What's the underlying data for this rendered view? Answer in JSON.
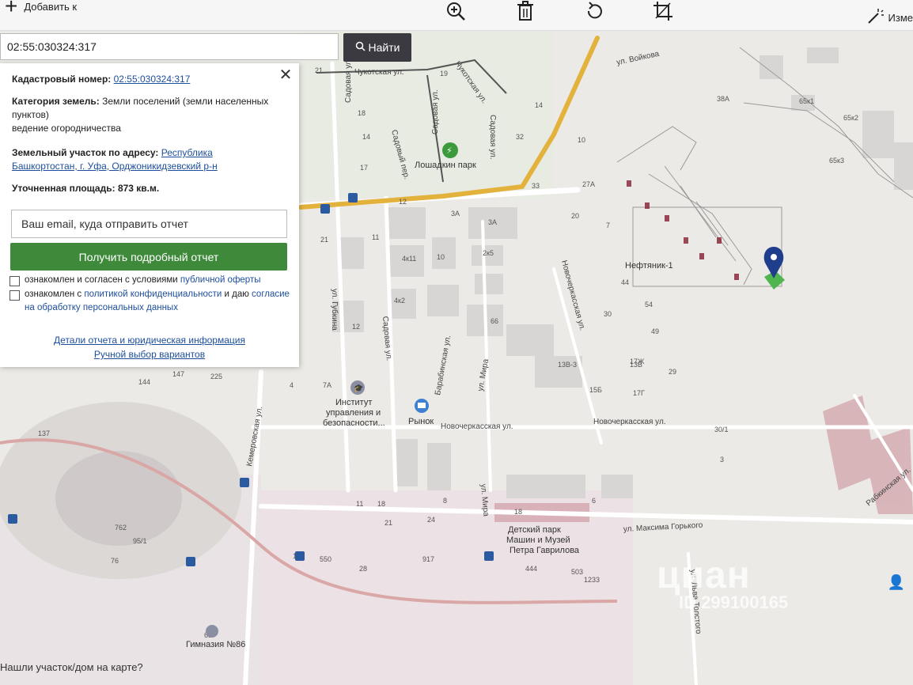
{
  "toolbar": {
    "add_label": "Добавить к",
    "edit_label": "Изме"
  },
  "search": {
    "value": "02:55:030324:317",
    "button_label": "Найти"
  },
  "panel": {
    "cadastral_label": "Кадастровый номер:",
    "cadastral_value": "02:55:030324:317",
    "category_label": "Категория земель:",
    "category_value": "Земли поселений (земли населенных пунктов)",
    "usage": "ведение огородничества",
    "address_label": "Земельный участок по адресу:",
    "address_value": "Республика Башкортостан, г. Уфа, Орджоникидзевский р-н",
    "area_label": "Уточненная площадь:",
    "area_value": "873 кв.м.",
    "email_placeholder": "Ваш email, куда отправить отчет",
    "report_button": "Получить подробный отчет",
    "consent1_text": "ознакомлен и согласен с условиями",
    "consent1_link": "публичной оферты",
    "consent2_text1": "ознакомлен с",
    "consent2_link1": "политикой конфиденциальности",
    "consent2_text2": "и даю",
    "consent2_link2": "согласие на обработку персональных данных",
    "details_link": "Детали отчета и юридическая информация",
    "manual_link": "Ручной выбор вариантов"
  },
  "map": {
    "streets": {
      "chukotskaya": "Чукотская ул.",
      "chukotskaya2": "Чукотская ул.",
      "voykova": "ул. Войкова",
      "sadovaya1": "Садовая ул.",
      "sadovaya2": "Садовая ул.",
      "sadovaya3": "Садовая ул.",
      "sadovy_per": "Садовый пер.",
      "gubkina": "ул. Губкина",
      "barabinskaya": "Барабинская ул.",
      "mira1": "ул. Мира",
      "mira2": "ул. Мира",
      "novocherkasskaya1": "Новочеркасская ул.",
      "novocherkasskaya2": "Новочеркасская ул.",
      "novocherkasskaya3": "Новочеркасская ул.",
      "kemerovskaya": "Кемеровская ул.",
      "gorkogo": "ул. Максима Горького",
      "rabkinskaya": "Рабкинская ул.",
      "pushkina": "ул. Льва Толстого"
    },
    "pois": {
      "park": "Лошадкин парк",
      "institute1": "Институт",
      "institute2": "управления и",
      "institute3": "безопасности...",
      "market": "Рынок",
      "kids_park1": "Детский парк",
      "kids_park2": "Машин и Музей",
      "kids_park3": "Петра Гаврилова",
      "gymnasium": "Гимназия №86",
      "neftyanik": "Нефтяник-1"
    },
    "house_numbers": [
      "21",
      "19",
      "18",
      "14",
      "17",
      "12",
      "32",
      "10",
      "33",
      "27А",
      "20",
      "7",
      "44",
      "54",
      "30",
      "49",
      "29",
      "17Ж",
      "17Г",
      "15Б",
      "13В-3",
      "66",
      "4к11",
      "10",
      "2к5",
      "3А",
      "3А",
      "4к2",
      "21",
      "11",
      "12",
      "4",
      "7А",
      "144",
      "147",
      "225",
      "137",
      "762",
      "95/1",
      "76",
      "65",
      "550",
      "28",
      "917",
      "24",
      "11",
      "18",
      "21",
      "444",
      "503",
      "1233",
      "13В",
      "30/1",
      "3",
      "38А",
      "65к1",
      "65к2",
      "65к3",
      "1",
      "4",
      "8",
      "6"
    ],
    "bottom_hint": "Нашли участок/дом на карте?"
  },
  "watermark": {
    "logo": "циан",
    "id": "ID 299100165"
  },
  "icons": {
    "zoom": "zoom-in-icon",
    "trash": "trash-icon",
    "rotate": "rotate-icon",
    "crop": "crop-icon",
    "magic": "magic-wand-icon",
    "search": "search-icon",
    "close": "close-icon",
    "pin": "map-pin-icon",
    "bus": "bus-stop-icon"
  },
  "colors": {
    "report_button": "#3e8a3a",
    "search_button": "#3b3a40",
    "link": "#1c4e9b",
    "main_road": "#e2b23d",
    "pin": "#1f3f8c",
    "parcel": "#8b2b3e"
  }
}
